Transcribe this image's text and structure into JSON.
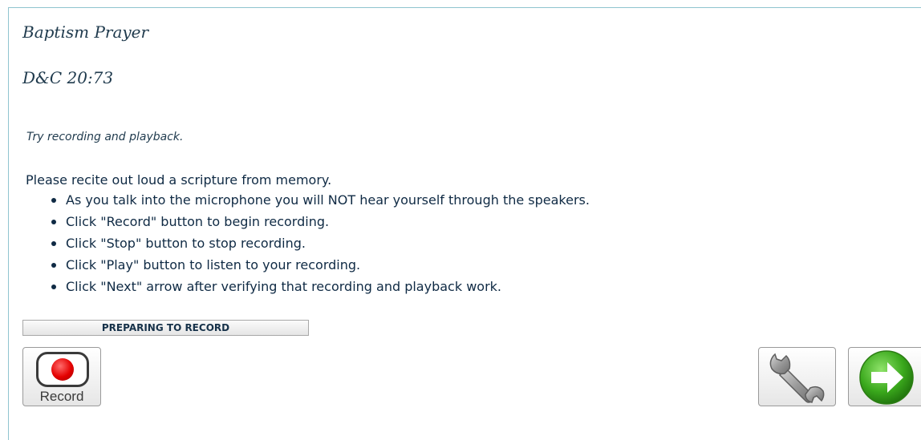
{
  "lesson": {
    "title": "Baptism Prayer",
    "reference": "D&C 20:73"
  },
  "hint": "Try recording and playback.",
  "instructions": {
    "lead": "Please recite out loud a scripture from memory.",
    "items": [
      "As you talk into the microphone you will NOT hear yourself through the speakers.",
      "Click \"Record\" button to begin recording.",
      "Click \"Stop\" button to stop recording.",
      "Click \"Play\" button to listen to your recording.",
      "Click \"Next\" arrow after verifying that recording and playback work."
    ]
  },
  "status": "PREPARING TO RECORD",
  "controls": {
    "record_label": "Record",
    "record_icon": "record-dot-icon",
    "tools_icon": "wrench-icon",
    "next_icon": "next-arrow-icon"
  },
  "colors": {
    "text": "#1f3a4d",
    "record_red": "#e40000",
    "next_green": "#3aa81c",
    "frame_border": "#8fc4cf"
  }
}
